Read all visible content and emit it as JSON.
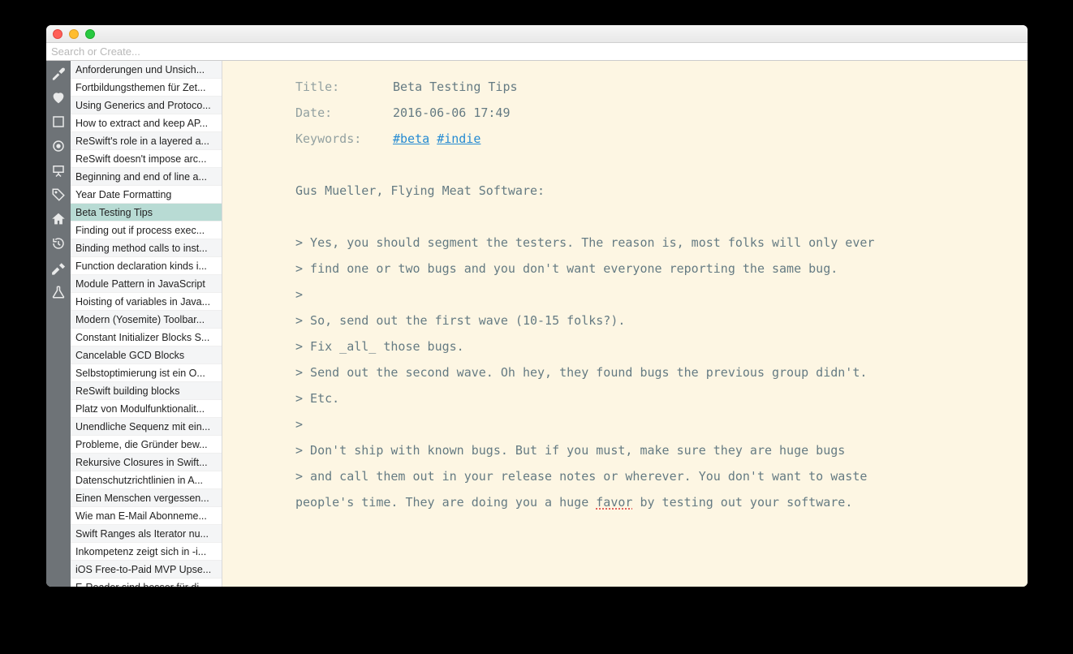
{
  "search": {
    "placeholder": "Search or Create..."
  },
  "sidebar_icons": [
    "wrench-icon",
    "heart-icon",
    "book-icon",
    "target-icon",
    "easel-icon",
    "tag-icon",
    "home-icon",
    "history-icon",
    "hammer-icon",
    "flask-icon"
  ],
  "notes": [
    {
      "title": "Anforderungen und Unsich...",
      "sel": false
    },
    {
      "title": "Fortbildungsthemen für Zet...",
      "sel": false
    },
    {
      "title": "Using Generics and Protoco...",
      "sel": false
    },
    {
      "title": "How to extract and keep AP...",
      "sel": false
    },
    {
      "title": "ReSwift's role in a layered a...",
      "sel": false
    },
    {
      "title": "ReSwift doesn't impose arc...",
      "sel": false
    },
    {
      "title": "Beginning and end of line a...",
      "sel": false
    },
    {
      "title": "Year Date Formatting",
      "sel": false
    },
    {
      "title": "Beta Testing Tips",
      "sel": true
    },
    {
      "title": "Finding out if process exec...",
      "sel": false
    },
    {
      "title": "Binding method calls to inst...",
      "sel": false
    },
    {
      "title": "Function declaration kinds i...",
      "sel": false
    },
    {
      "title": "Module Pattern in JavaScript",
      "sel": false
    },
    {
      "title": "Hoisting of variables in Java...",
      "sel": false
    },
    {
      "title": "Modern (Yosemite) Toolbar...",
      "sel": false
    },
    {
      "title": "Constant Initializer Blocks S...",
      "sel": false
    },
    {
      "title": "Cancelable GCD Blocks",
      "sel": false
    },
    {
      "title": "Selbstoptimierung ist ein O...",
      "sel": false
    },
    {
      "title": "ReSwift building blocks",
      "sel": false
    },
    {
      "title": "Platz von Modulfunktionalit...",
      "sel": false
    },
    {
      "title": "Unendliche Sequenz mit ein...",
      "sel": false
    },
    {
      "title": "Probleme, die Gründer bew...",
      "sel": false
    },
    {
      "title": "Rekursive Closures in Swift...",
      "sel": false
    },
    {
      "title": "Datenschutzrichtlinien in A...",
      "sel": false
    },
    {
      "title": "Einen Menschen vergessen...",
      "sel": false
    },
    {
      "title": "Wie man E-Mail Abonneme...",
      "sel": false
    },
    {
      "title": "Swift Ranges als Iterator nu...",
      "sel": false
    },
    {
      "title": "Inkompetenz zeigt sich in -i...",
      "sel": false
    },
    {
      "title": "iOS Free-to-Paid MVP Upse...",
      "sel": false
    },
    {
      "title": "E-Reader sind besser für di...",
      "sel": false
    }
  ],
  "note": {
    "labels": {
      "title": "Title:",
      "date": "Date:",
      "keywords": "Keywords:"
    },
    "title": "Beta Testing Tips",
    "date": "2016-06-06 17:49",
    "keywords": [
      {
        "tag": "#beta"
      },
      {
        "tag": "#indie"
      }
    ],
    "body_lines": [
      "Gus Mueller, Flying Meat Software:",
      "",
      "> Yes, you should segment the testers. The reason is, most folks will only ever",
      "> find one or two bugs and you don't want everyone reporting the same bug.",
      ">",
      "> So, send out the first wave (10-15 folks?).",
      "> Fix _all_ those bugs.",
      "> Send out the second wave. Oh hey, they found bugs the previous group didn't.",
      "> Etc.",
      ">",
      "> Don't ship with known bugs. But if you must, make sure they are huge bugs",
      "> and call them out in your release notes or wherever. You don't want to waste"
    ],
    "last_line_pre": "people's time. They are doing you a huge ",
    "last_line_spell": "favor",
    "last_line_post": " by testing out your software."
  }
}
